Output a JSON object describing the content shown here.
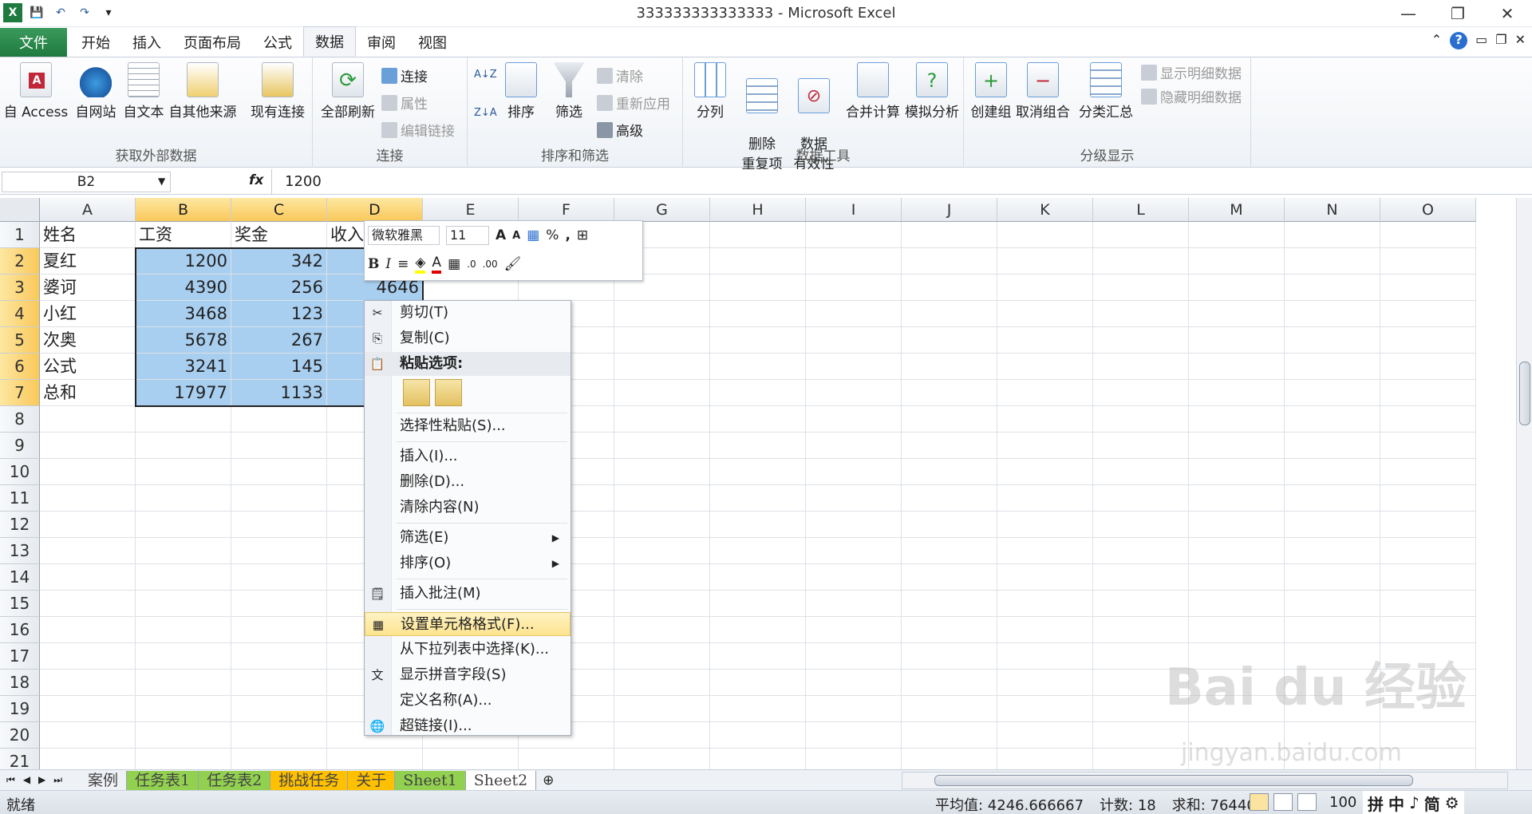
{
  "window": {
    "title": "333333333333333 - Microsoft Excel"
  },
  "tabs": [
    "文件",
    "开始",
    "插入",
    "页面布局",
    "公式",
    "数据",
    "审阅",
    "视图"
  ],
  "active_tab": "数据",
  "ribbon": {
    "groups": [
      {
        "label": "获取外部数据",
        "buttons": [
          "自 Access",
          "自网站",
          "自文本",
          "自其他来源",
          "现有连接"
        ]
      },
      {
        "label": "连接",
        "buttons": [
          "全部刷新"
        ],
        "small": [
          "连接",
          "属性",
          "编辑链接"
        ]
      },
      {
        "label": "排序和筛选",
        "buttons": [
          "排序",
          "筛选"
        ],
        "small": [
          "清除",
          "重新应用",
          "高级"
        ]
      },
      {
        "label": "数据工具",
        "buttons": [
          "分列",
          "删除\n重复项",
          "数据\n有效性",
          "合并计算",
          "模拟分析"
        ]
      },
      {
        "label": "分级显示",
        "buttons": [
          "创建组",
          "取消组合",
          "分类汇总"
        ],
        "small": [
          "显示明细数据",
          "隐藏明细数据"
        ]
      }
    ]
  },
  "formula_bar": {
    "name_box": "B2",
    "fx": "fx",
    "value": "1200"
  },
  "columns": [
    "A",
    "B",
    "C",
    "D",
    "E",
    "F",
    "G",
    "H",
    "I",
    "J",
    "K",
    "L",
    "M",
    "N",
    "O"
  ],
  "rows": [
    "1",
    "2",
    "3",
    "4",
    "5",
    "6",
    "7",
    "8",
    "9",
    "10",
    "11",
    "12",
    "13",
    "14",
    "15",
    "16",
    "17",
    "18",
    "19",
    "20",
    "21"
  ],
  "cells": {
    "header": [
      "姓名",
      "工资",
      "奖金",
      "收入"
    ],
    "data": [
      [
        "夏红",
        "1200",
        "342"
      ],
      [
        "婆诃",
        "4390",
        "256",
        "4646"
      ],
      [
        "小红",
        "3468",
        "123"
      ],
      [
        "次奥",
        "5678",
        "267"
      ],
      [
        "公式",
        "3241",
        "145"
      ],
      [
        "总和",
        "17977",
        "1133"
      ]
    ]
  },
  "mini_toolbar": {
    "font": "微软雅黑",
    "size": "11",
    "percent": "%",
    "comma": ","
  },
  "context_menu": {
    "items": [
      "剪切(T)",
      "复制(C)",
      "粘贴选项:",
      "选择性粘贴(S)...",
      "插入(I)...",
      "删除(D)...",
      "清除内容(N)",
      "筛选(E)",
      "排序(O)",
      "插入批注(M)",
      "设置单元格格式(F)...",
      "从下拉列表中选择(K)...",
      "显示拼音字段(S)",
      "定义名称(A)...",
      "超链接(I)..."
    ]
  },
  "sheet_tabs": [
    "案例",
    "任务表1",
    "任务表2",
    "挑战任务",
    "关于",
    "Sheet1",
    "Sheet2"
  ],
  "status": {
    "ready": "就绪",
    "average": "平均值: 4246.666667",
    "count": "计数: 18",
    "sum": "求和: 76440",
    "zoom": "100"
  },
  "ime": [
    "拼",
    "中",
    "♪",
    "简"
  ],
  "watermark": {
    "main": "Bai du 经验",
    "sub": "jingyan.baidu.com"
  }
}
